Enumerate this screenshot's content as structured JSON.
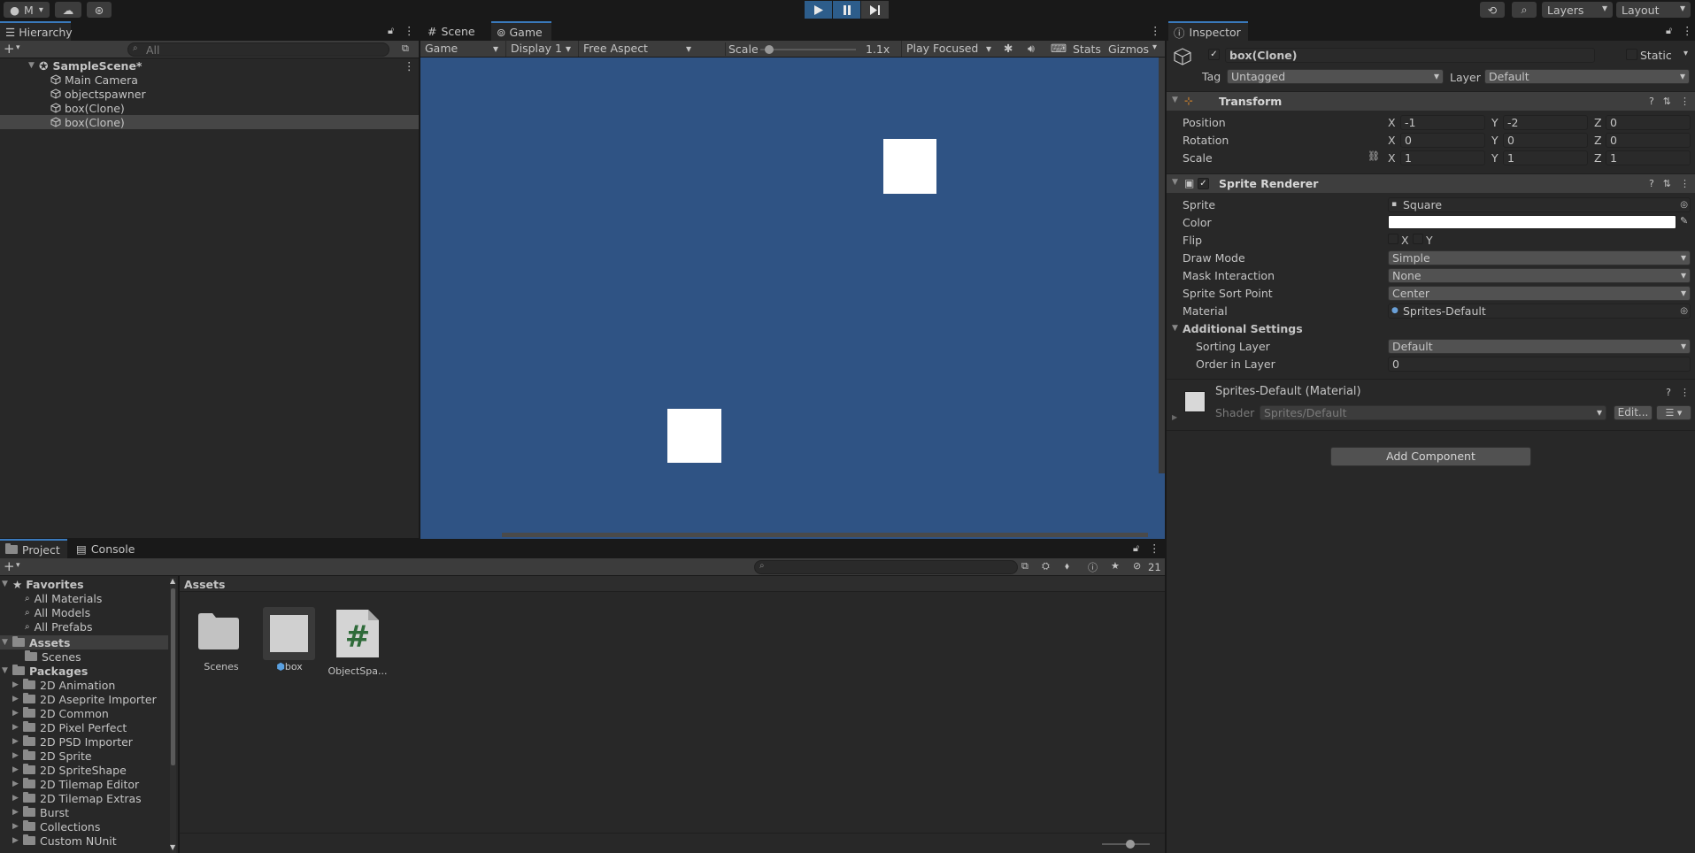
{
  "toolbar": {
    "account_label": "M",
    "layers_label": "Layers",
    "layout_label": "Layout"
  },
  "hierarchy": {
    "tab": "Hierarchy",
    "search_placeholder": "All",
    "scene": "SampleScene*",
    "items": [
      {
        "label": "Main Camera"
      },
      {
        "label": "objectspawner"
      },
      {
        "label": "box(Clone)"
      },
      {
        "label": "box(Clone)"
      }
    ]
  },
  "game_view": {
    "tab_scene": "Scene",
    "tab_game": "Game",
    "mode": "Game",
    "display": "Display 1",
    "aspect": "Free Aspect",
    "scale_label": "Scale",
    "scale_value": "1.1x",
    "play_mode": "Play Focused",
    "stats": "Stats",
    "gizmos": "Gizmos",
    "bg_color": "#2f5384"
  },
  "inspector": {
    "tab": "Inspector",
    "object_name": "box(Clone)",
    "static_label": "Static",
    "tag_label": "Tag",
    "tag_value": "Untagged",
    "layer_label": "Layer",
    "layer_value": "Default",
    "transform": {
      "title": "Transform",
      "position_label": "Position",
      "rotation_label": "Rotation",
      "scale_label": "Scale",
      "pos": {
        "x": "-1",
        "y": "-2",
        "z": "0"
      },
      "rot": {
        "x": "0",
        "y": "0",
        "z": "0"
      },
      "scl": {
        "x": "1",
        "y": "1",
        "z": "1"
      },
      "ax": "X",
      "ay": "Y",
      "az": "Z"
    },
    "sprite_renderer": {
      "title": "Sprite Renderer",
      "sprite_label": "Sprite",
      "sprite_value": "Square",
      "color_label": "Color",
      "flip_label": "Flip",
      "flip_x": "X",
      "flip_y": "Y",
      "draw_mode_label": "Draw Mode",
      "draw_mode_value": "Simple",
      "mask_label": "Mask Interaction",
      "mask_value": "None",
      "sort_point_label": "Sprite Sort Point",
      "sort_point_value": "Center",
      "material_label": "Material",
      "material_value": "Sprites-Default",
      "additional_label": "Additional Settings",
      "sorting_layer_label": "Sorting Layer",
      "sorting_layer_value": "Default",
      "order_label": "Order in Layer",
      "order_value": "0"
    },
    "material": {
      "title": "Sprites-Default (Material)",
      "shader_label": "Shader",
      "shader_value": "Sprites/Default",
      "edit_label": "Edit..."
    },
    "add_component": "Add Component"
  },
  "project": {
    "tab_project": "Project",
    "tab_console": "Console",
    "hidden_count": "21",
    "favorites_label": "Favorites",
    "favorites": [
      "All Materials",
      "All Models",
      "All Prefabs"
    ],
    "assets_label": "Assets",
    "assets_children": [
      "Scenes"
    ],
    "packages_label": "Packages",
    "packages": [
      "2D Animation",
      "2D Aseprite Importer",
      "2D Common",
      "2D Pixel Perfect",
      "2D PSD Importer",
      "2D Sprite",
      "2D SpriteShape",
      "2D Tilemap Editor",
      "2D Tilemap Extras",
      "Burst",
      "Collections",
      "Custom NUnit"
    ],
    "breadcrumb": "Assets",
    "asset_items": [
      {
        "label": "Scenes",
        "icon": "folder-icon"
      },
      {
        "label": "box",
        "icon": "prefab-icon"
      },
      {
        "label": "ObjectSpa...",
        "icon": "csharp-script-icon"
      }
    ]
  }
}
